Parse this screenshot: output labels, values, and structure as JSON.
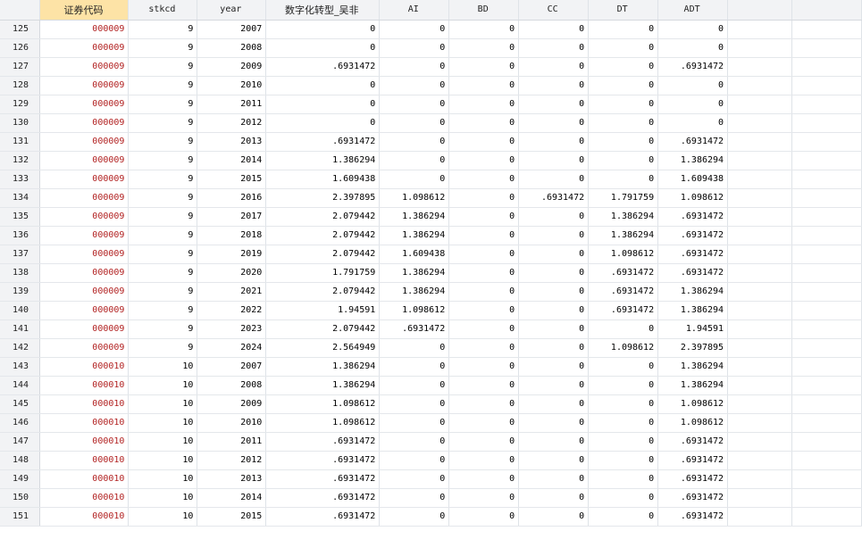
{
  "columns": [
    "证券代码",
    "stkcd",
    "year",
    "数字化转型_吴非",
    "AI",
    "BD",
    "CC",
    "DT",
    "ADT"
  ],
  "rows": [
    {
      "n": "125",
      "code": "000009",
      "stkcd": "9",
      "year": "2007",
      "dt_wufei": "0",
      "ai": "0",
      "bd": "0",
      "cc": "0",
      "dt": "0",
      "adt": "0"
    },
    {
      "n": "126",
      "code": "000009",
      "stkcd": "9",
      "year": "2008",
      "dt_wufei": "0",
      "ai": "0",
      "bd": "0",
      "cc": "0",
      "dt": "0",
      "adt": "0"
    },
    {
      "n": "127",
      "code": "000009",
      "stkcd": "9",
      "year": "2009",
      "dt_wufei": ".6931472",
      "ai": "0",
      "bd": "0",
      "cc": "0",
      "dt": "0",
      "adt": ".6931472"
    },
    {
      "n": "128",
      "code": "000009",
      "stkcd": "9",
      "year": "2010",
      "dt_wufei": "0",
      "ai": "0",
      "bd": "0",
      "cc": "0",
      "dt": "0",
      "adt": "0"
    },
    {
      "n": "129",
      "code": "000009",
      "stkcd": "9",
      "year": "2011",
      "dt_wufei": "0",
      "ai": "0",
      "bd": "0",
      "cc": "0",
      "dt": "0",
      "adt": "0"
    },
    {
      "n": "130",
      "code": "000009",
      "stkcd": "9",
      "year": "2012",
      "dt_wufei": "0",
      "ai": "0",
      "bd": "0",
      "cc": "0",
      "dt": "0",
      "adt": "0"
    },
    {
      "n": "131",
      "code": "000009",
      "stkcd": "9",
      "year": "2013",
      "dt_wufei": ".6931472",
      "ai": "0",
      "bd": "0",
      "cc": "0",
      "dt": "0",
      "adt": ".6931472"
    },
    {
      "n": "132",
      "code": "000009",
      "stkcd": "9",
      "year": "2014",
      "dt_wufei": "1.386294",
      "ai": "0",
      "bd": "0",
      "cc": "0",
      "dt": "0",
      "adt": "1.386294"
    },
    {
      "n": "133",
      "code": "000009",
      "stkcd": "9",
      "year": "2015",
      "dt_wufei": "1.609438",
      "ai": "0",
      "bd": "0",
      "cc": "0",
      "dt": "0",
      "adt": "1.609438"
    },
    {
      "n": "134",
      "code": "000009",
      "stkcd": "9",
      "year": "2016",
      "dt_wufei": "2.397895",
      "ai": "1.098612",
      "bd": "0",
      "cc": ".6931472",
      "dt": "1.791759",
      "adt": "1.098612"
    },
    {
      "n": "135",
      "code": "000009",
      "stkcd": "9",
      "year": "2017",
      "dt_wufei": "2.079442",
      "ai": "1.386294",
      "bd": "0",
      "cc": "0",
      "dt": "1.386294",
      "adt": ".6931472"
    },
    {
      "n": "136",
      "code": "000009",
      "stkcd": "9",
      "year": "2018",
      "dt_wufei": "2.079442",
      "ai": "1.386294",
      "bd": "0",
      "cc": "0",
      "dt": "1.386294",
      "adt": ".6931472"
    },
    {
      "n": "137",
      "code": "000009",
      "stkcd": "9",
      "year": "2019",
      "dt_wufei": "2.079442",
      "ai": "1.609438",
      "bd": "0",
      "cc": "0",
      "dt": "1.098612",
      "adt": ".6931472"
    },
    {
      "n": "138",
      "code": "000009",
      "stkcd": "9",
      "year": "2020",
      "dt_wufei": "1.791759",
      "ai": "1.386294",
      "bd": "0",
      "cc": "0",
      "dt": ".6931472",
      "adt": ".6931472"
    },
    {
      "n": "139",
      "code": "000009",
      "stkcd": "9",
      "year": "2021",
      "dt_wufei": "2.079442",
      "ai": "1.386294",
      "bd": "0",
      "cc": "0",
      "dt": ".6931472",
      "adt": "1.386294"
    },
    {
      "n": "140",
      "code": "000009",
      "stkcd": "9",
      "year": "2022",
      "dt_wufei": "1.94591",
      "ai": "1.098612",
      "bd": "0",
      "cc": "0",
      "dt": ".6931472",
      "adt": "1.386294"
    },
    {
      "n": "141",
      "code": "000009",
      "stkcd": "9",
      "year": "2023",
      "dt_wufei": "2.079442",
      "ai": ".6931472",
      "bd": "0",
      "cc": "0",
      "dt": "0",
      "adt": "1.94591"
    },
    {
      "n": "142",
      "code": "000009",
      "stkcd": "9",
      "year": "2024",
      "dt_wufei": "2.564949",
      "ai": "0",
      "bd": "0",
      "cc": "0",
      "dt": "1.098612",
      "adt": "2.397895"
    },
    {
      "n": "143",
      "code": "000010",
      "stkcd": "10",
      "year": "2007",
      "dt_wufei": "1.386294",
      "ai": "0",
      "bd": "0",
      "cc": "0",
      "dt": "0",
      "adt": "1.386294"
    },
    {
      "n": "144",
      "code": "000010",
      "stkcd": "10",
      "year": "2008",
      "dt_wufei": "1.386294",
      "ai": "0",
      "bd": "0",
      "cc": "0",
      "dt": "0",
      "adt": "1.386294"
    },
    {
      "n": "145",
      "code": "000010",
      "stkcd": "10",
      "year": "2009",
      "dt_wufei": "1.098612",
      "ai": "0",
      "bd": "0",
      "cc": "0",
      "dt": "0",
      "adt": "1.098612"
    },
    {
      "n": "146",
      "code": "000010",
      "stkcd": "10",
      "year": "2010",
      "dt_wufei": "1.098612",
      "ai": "0",
      "bd": "0",
      "cc": "0",
      "dt": "0",
      "adt": "1.098612"
    },
    {
      "n": "147",
      "code": "000010",
      "stkcd": "10",
      "year": "2011",
      "dt_wufei": ".6931472",
      "ai": "0",
      "bd": "0",
      "cc": "0",
      "dt": "0",
      "adt": ".6931472"
    },
    {
      "n": "148",
      "code": "000010",
      "stkcd": "10",
      "year": "2012",
      "dt_wufei": ".6931472",
      "ai": "0",
      "bd": "0",
      "cc": "0",
      "dt": "0",
      "adt": ".6931472"
    },
    {
      "n": "149",
      "code": "000010",
      "stkcd": "10",
      "year": "2013",
      "dt_wufei": ".6931472",
      "ai": "0",
      "bd": "0",
      "cc": "0",
      "dt": "0",
      "adt": ".6931472"
    },
    {
      "n": "150",
      "code": "000010",
      "stkcd": "10",
      "year": "2014",
      "dt_wufei": ".6931472",
      "ai": "0",
      "bd": "0",
      "cc": "0",
      "dt": "0",
      "adt": ".6931472"
    },
    {
      "n": "151",
      "code": "000010",
      "stkcd": "10",
      "year": "2015",
      "dt_wufei": ".6931472",
      "ai": "0",
      "bd": "0",
      "cc": "0",
      "dt": "0",
      "adt": ".6931472"
    }
  ],
  "colors": {
    "code_text": "#b22222",
    "selected_header": "#fde3a6",
    "header_bg": "#f2f3f5"
  }
}
